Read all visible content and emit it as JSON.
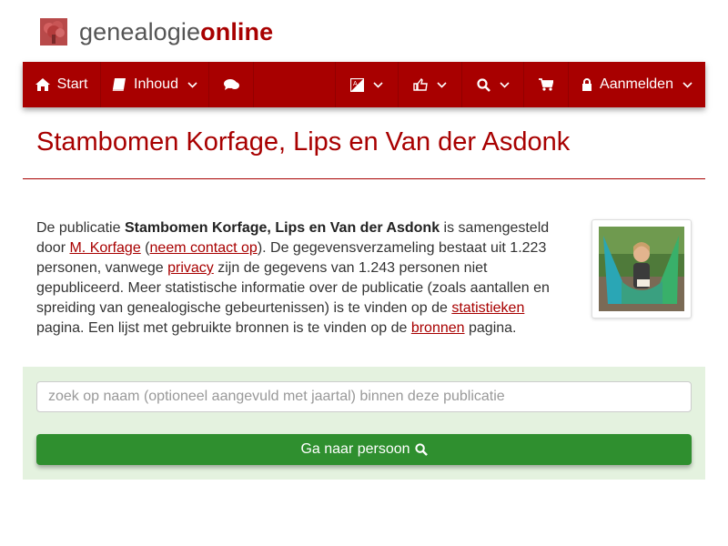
{
  "logo": {
    "part1": "genealogie",
    "part2": "online",
    "icon": "tree-icon"
  },
  "nav": {
    "start": "Start",
    "inhoud": "Inhoud",
    "aanmelden": "Aanmelden",
    "icons": [
      "home-icon",
      "book-icon",
      "comments-icon",
      "language-icon",
      "thumbs-up-icon",
      "search-icon",
      "cart-icon",
      "lock-icon"
    ]
  },
  "page": {
    "title": "Stambomen Korfage, Lips en Van der Asdonk"
  },
  "intro": {
    "t1": "De publicatie ",
    "pub_name": "Stambomen Korfage, Lips en Van der Asdonk",
    "t2": " is samengesteld door ",
    "author": "M. Korfage",
    "t3": " (",
    "contact": "neem contact op",
    "t4": "). De gegevensverzameling bestaat uit 1.223 personen, vanwege ",
    "privacy": "privacy",
    "t5": " zijn de gegevens van 1.243 personen niet gepubliceerd. Meer statistische informatie over de publicatie (zoals aantallen en spreiding van genealogische gebeurtenissen) is te vinden op de ",
    "stats": "statistieken",
    "t6": " pagina. Een lijst met gebruikte bronnen is te vinden op de ",
    "sources": "bronnen",
    "t7": " pagina."
  },
  "search": {
    "placeholder": "zoek op naam (optioneel aangevuld met jaartal) binnen deze publicatie",
    "value": "",
    "button": "Ga naar persoon"
  },
  "colors": {
    "brand": "#a80000",
    "button_green": "#2f8f2f",
    "panel_green": "#e4f2df"
  }
}
